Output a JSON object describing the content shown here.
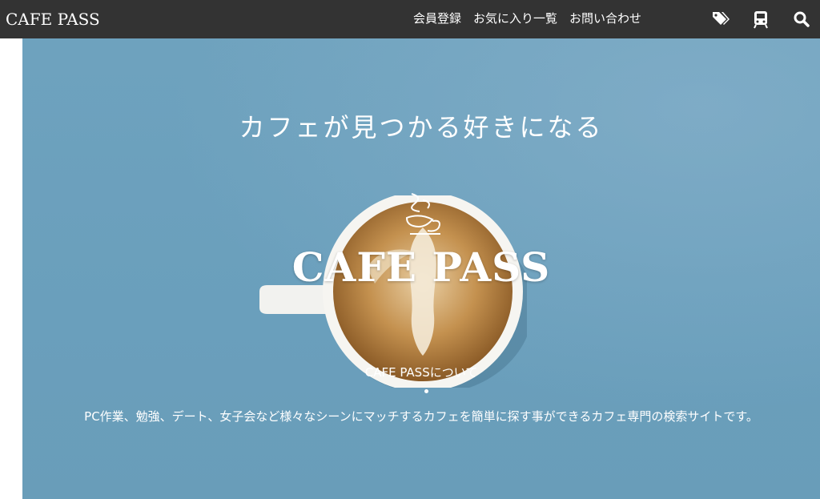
{
  "nav": {
    "brand": "CAFE PASS",
    "links": [
      {
        "label": "会員登録"
      },
      {
        "label": "お気に入り一覧"
      },
      {
        "label": "お問い合わせ"
      }
    ],
    "icons": [
      "tags-icon",
      "train-icon",
      "search-icon"
    ]
  },
  "hero": {
    "tagline": "カフェが見つかる好きになる",
    "logo_text": "CAFE PASS",
    "about_label": "CAFE PASSについて",
    "description": "PC作業、勉強、デート、女子会など様々なシーンにマッチするカフェを簡単に探す事ができるカフェ専門の検索サイトです。"
  },
  "colors": {
    "nav_background": "#333333",
    "hero_background": "#6ea2be",
    "text": "#ffffff"
  }
}
